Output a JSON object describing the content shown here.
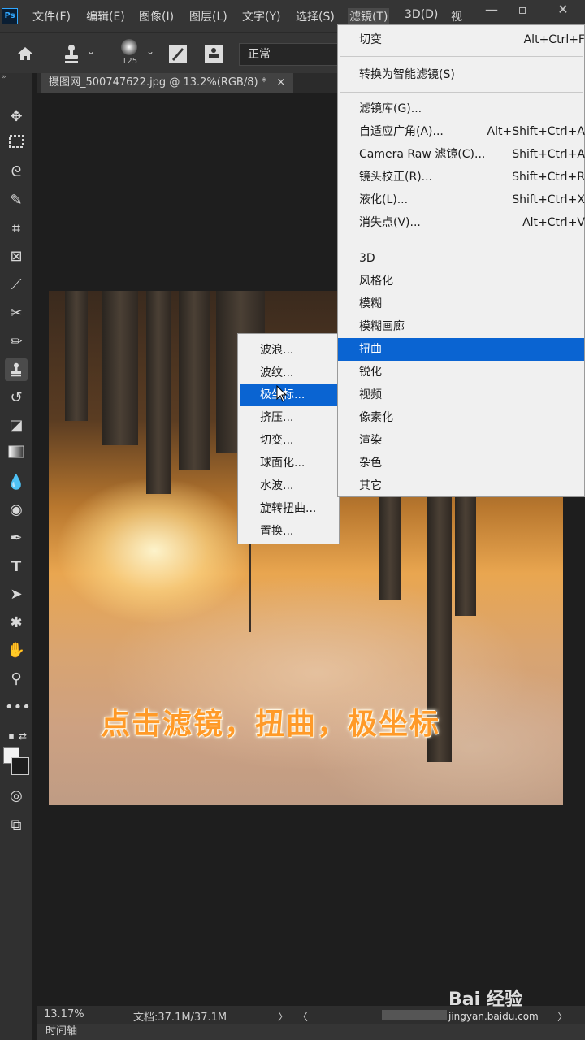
{
  "app": {
    "logo": "Ps"
  },
  "menubar": {
    "items": [
      "文件(F)",
      "编辑(E)",
      "图像(I)",
      "图层(L)",
      "文字(Y)",
      "选择(S)",
      "滤镜(T)",
      "3D(D)",
      "视"
    ],
    "active_index": 6
  },
  "options_bar": {
    "brush_size": "125",
    "blend_mode": "正常",
    "icons": [
      "home-icon",
      "clone-stamp-icon",
      "chevron-down-icon",
      "brush-preset-icon",
      "toggle-brush-panel-icon",
      "toggle-clone-source-icon"
    ]
  },
  "document_tab": {
    "title": "摄图网_500747622.jpg @ 13.2%(RGB/8) *",
    "close": "×"
  },
  "filter_menu": {
    "groups": [
      [
        {
          "label": "切变",
          "shortcut": "Alt+Ctrl+F"
        }
      ],
      [
        {
          "label": "转换为智能滤镜(S)",
          "shortcut": ""
        }
      ],
      [
        {
          "label": "滤镜库(G)...",
          "shortcut": ""
        },
        {
          "label": "自适应广角(A)...",
          "shortcut": "Alt+Shift+Ctrl+A"
        },
        {
          "label": "Camera Raw 滤镜(C)...",
          "shortcut": "Shift+Ctrl+A"
        },
        {
          "label": "镜头校正(R)...",
          "shortcut": "Shift+Ctrl+R"
        },
        {
          "label": "液化(L)...",
          "shortcut": "Shift+Ctrl+X"
        },
        {
          "label": "消失点(V)...",
          "shortcut": "Alt+Ctrl+V"
        }
      ],
      [
        {
          "label": "3D",
          "shortcut": ""
        },
        {
          "label": "风格化",
          "shortcut": ""
        },
        {
          "label": "模糊",
          "shortcut": ""
        },
        {
          "label": "模糊画廊",
          "shortcut": ""
        },
        {
          "label": "扭曲",
          "shortcut": "",
          "highlighted": true
        },
        {
          "label": "锐化",
          "shortcut": ""
        },
        {
          "label": "视频",
          "shortcut": ""
        },
        {
          "label": "像素化",
          "shortcut": ""
        },
        {
          "label": "渲染",
          "shortcut": ""
        },
        {
          "label": "杂色",
          "shortcut": ""
        },
        {
          "label": "其它",
          "shortcut": ""
        }
      ]
    ]
  },
  "distort_submenu": {
    "items": [
      "波浪...",
      "波纹...",
      "极坐标...",
      "挤压...",
      "切变...",
      "球面化...",
      "水波...",
      "旋转扭曲...",
      "置换..."
    ],
    "highlighted_index": 2
  },
  "canvas": {
    "caption": "点击滤镜，扭曲，极坐标"
  },
  "status_bar": {
    "zoom": "13.17%",
    "doc_size": "文档:37.1M/37.1M",
    "arrow": "〉",
    "scroll_left": "〈",
    "scroll_right": "〉"
  },
  "timeline": {
    "label": "时间轴"
  },
  "watermark": {
    "brand": "Bai 经验",
    "url": "jingyan.baidu.com"
  },
  "toolbar": {
    "tools": [
      "move-tool-icon",
      "marquee-tool-icon",
      "lasso-tool-icon",
      "quick-select-tool-icon",
      "crop-tool-icon",
      "frame-tool-icon",
      "eyedropper-tool-icon",
      "healing-brush-tool-icon",
      "brush-tool-icon",
      "clone-stamp-tool-icon",
      "history-brush-tool-icon",
      "eraser-tool-icon",
      "gradient-tool-icon",
      "blur-tool-icon",
      "dodge-tool-icon",
      "pen-tool-icon",
      "type-tool-icon",
      "path-select-tool-icon",
      "shape-tool-icon",
      "hand-tool-icon",
      "zoom-tool-icon",
      "more-tools-icon"
    ],
    "active_tool": "clone-stamp-tool-icon"
  },
  "colors": {
    "accent": "#0a64d2",
    "caption": "#ff9a28",
    "menubar_bg": "#353535"
  }
}
